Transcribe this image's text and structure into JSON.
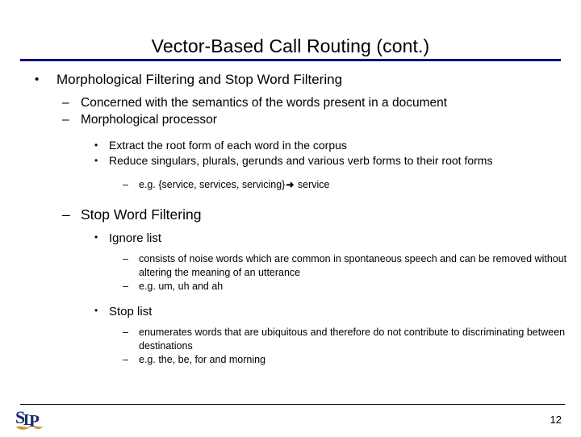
{
  "slide": {
    "title": "Vector-Based Call Routing (cont.)",
    "page_number": "12",
    "accent_color": "#000080",
    "rule_color": "#000000",
    "logo": {
      "name": "slp-logo",
      "letters": "SLP",
      "mark_color": "#1a2a6c",
      "accent_color": "#c79a3a"
    },
    "bullets": {
      "level1_marker": "•",
      "level2_marker": "–",
      "level3_marker": "•",
      "level4_marker": "–",
      "arrow_marker": "➜"
    },
    "content": {
      "heading": "Morphological Filtering and Stop Word Filtering",
      "concerned": "Concerned with the semantics of the words present in a document",
      "morph_processor": "Morphological processor",
      "extract_root": "Extract the root form of each word in the corpus",
      "reduce_forms": "Reduce singulars, plurals, gerunds and various verb forms to their root forms",
      "eg_service_pre": "e.g. {service, services, servicing}",
      "eg_service_post": "service",
      "stop_word_filtering": "Stop Word Filtering",
      "ignore_list": "Ignore list",
      "ignore_list_desc": "consists of noise words which are common in spontaneous speech and can be removed without altering the meaning of an utterance",
      "ignore_list_eg": "e.g. um, uh and ah",
      "stop_list": "Stop list",
      "stop_list_desc": "enumerates words that are ubiquitous and therefore do not contribute to discriminating between destinations",
      "stop_list_eg": " e.g. the, be, for and morning"
    }
  }
}
